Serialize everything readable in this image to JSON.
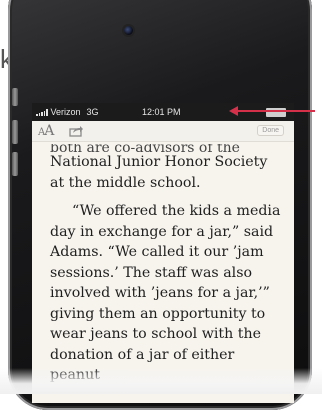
{
  "stray_letter": "k",
  "status_bar": {
    "carrier": "Verizon",
    "network": "3G",
    "time": "12:01 PM"
  },
  "reader_toolbar": {
    "font_size_label_small": "A",
    "font_size_label_large": "A",
    "done_label": "Done"
  },
  "article": {
    "cutoff_line": "both are co-advisors of the",
    "paragraph1": "National Junior Honor Society at the middle school.",
    "paragraph2": "“We offered the kids a media day in exchange for a jar,” said Adams. “We called it our ’jam sessions.’ The staff was also involved with ’jeans for a jar,’” giving them an opportunity to wear jeans to school with the donation of a jar of either peanut"
  },
  "colors": {
    "callout_arrow": "#d4304a",
    "status_bar_bg": "#1b1b1b",
    "page_bg": "#f7f4ee"
  },
  "icons": [
    "share-icon",
    "signal-bars-icon",
    "battery-icon",
    "callout-arrow-icon"
  ]
}
